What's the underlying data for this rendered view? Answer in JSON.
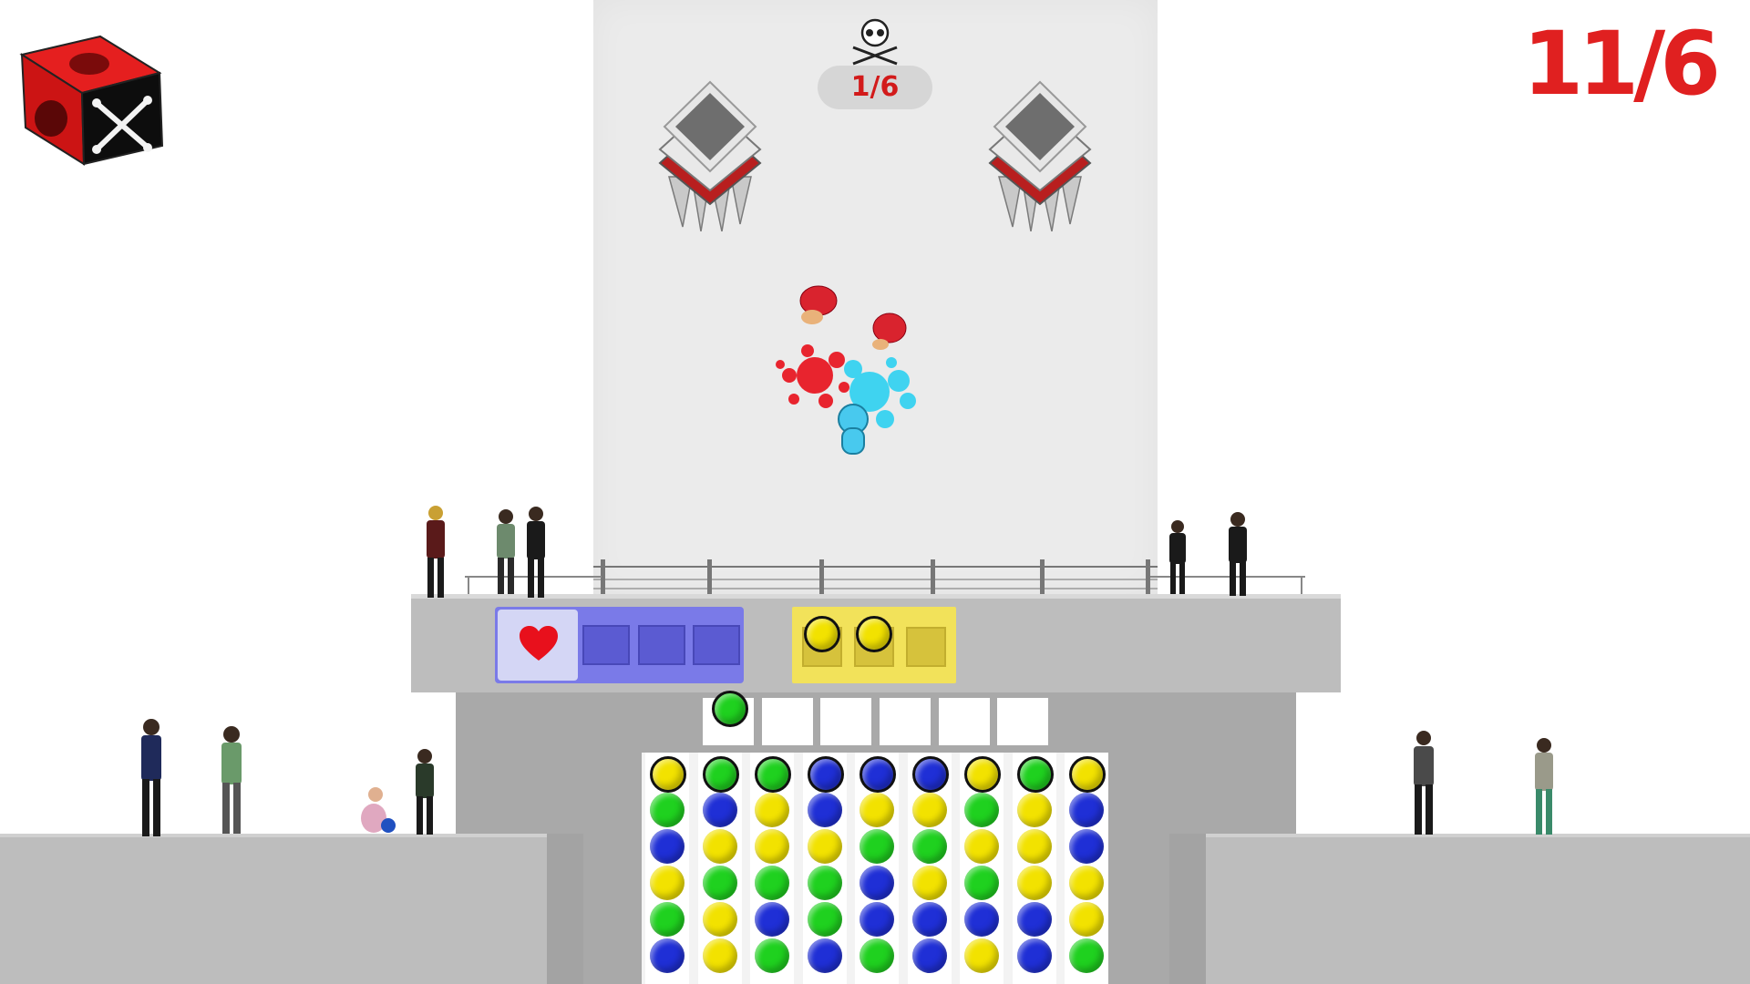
{
  "hud": {
    "level_counter": "11/6",
    "arena_counter": "1/6",
    "logo_icon": "skull-crossbones-cube-icon",
    "arena_icon": "skull-crossbones-icon"
  },
  "colors": {
    "red_accent": "#e02020",
    "yellow": "#f2e200",
    "green": "#1fd11f",
    "blue": "#1f2fd6",
    "purple_panel": "#7a7ae8",
    "yellow_panel": "#f2e25a"
  },
  "health_panel": {
    "icon": "heart-icon",
    "empty_slots": 3
  },
  "yellow_collector": {
    "filled": [
      "yellow",
      "yellow"
    ],
    "empty_slots": 1
  },
  "queue": {
    "items": [
      "green"
    ],
    "empty_slots": 5
  },
  "ball_grid": {
    "columns": [
      [
        "yellow",
        "green",
        "blue",
        "yellow",
        "green",
        "blue"
      ],
      [
        "green",
        "blue",
        "yellow",
        "green",
        "yellow",
        "yellow"
      ],
      [
        "green",
        "yellow",
        "yellow",
        "green",
        "blue",
        "green"
      ],
      [
        "blue",
        "blue",
        "yellow",
        "green",
        "green",
        "blue"
      ],
      [
        "blue",
        "yellow",
        "green",
        "blue",
        "blue",
        "green"
      ],
      [
        "blue",
        "yellow",
        "green",
        "yellow",
        "blue",
        "blue"
      ],
      [
        "yellow",
        "green",
        "yellow",
        "green",
        "blue",
        "yellow"
      ],
      [
        "green",
        "yellow",
        "yellow",
        "yellow",
        "blue",
        "blue"
      ],
      [
        "yellow",
        "blue",
        "blue",
        "yellow",
        "yellow",
        "green"
      ]
    ]
  },
  "characters": {
    "player": "blue-character",
    "enemies": [
      "red-character",
      "red-character"
    ]
  }
}
